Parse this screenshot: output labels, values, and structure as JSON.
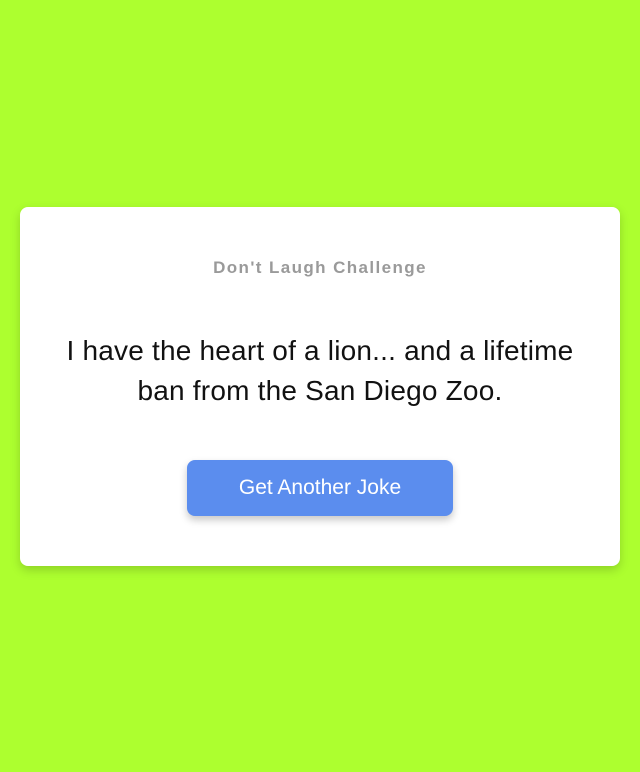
{
  "page": {
    "background_color": "#adff2f"
  },
  "card": {
    "subtitle": "Don't Laugh Challenge",
    "joke": "I have the heart of a lion... and a lifetime ban from the San Diego Zoo.",
    "button_label": "Get Another Joke",
    "button_color": "#5b8dee"
  }
}
